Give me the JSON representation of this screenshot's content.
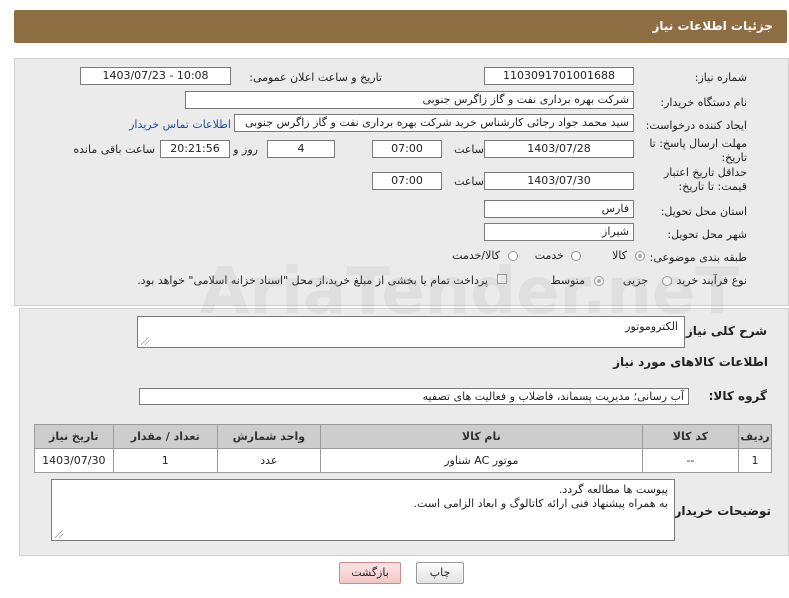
{
  "header": {
    "title": "جزئیات اطلاعات نیاز"
  },
  "form": {
    "need_number_label": "شماره نیاز:",
    "need_number": "1103091701001688",
    "announce_label": "تاریخ و ساعت اعلان عمومی:",
    "announce_value": "1403/07/23 - 10:08",
    "buyer_org_label": "نام دستگاه خریدار:",
    "buyer_org": "شرکت بهره برداری نفت و گاز زاگرس جنوبی",
    "creator_label": "ایجاد کننده درخواست:",
    "creator": "سید محمد جواد رجائی کارشناس خرید شرکت بهره برداری نفت و گاز زاگرس جنوبی",
    "contact_link": "اطلاعات تماس خریدار",
    "reply_deadline_label": "مهلت ارسال پاسخ: تا تاریخ:",
    "reply_date": "1403/07/28",
    "time_label": "ساعت",
    "reply_time": "07:00",
    "days_value": "4",
    "days_label": "روز و",
    "remaining_time": "20:21:56",
    "remaining_label": "ساعت باقی مانده",
    "price_validity_label": "حداقل تاریخ اعتبار قیمت: تا تاریخ:",
    "price_date": "1403/07/30",
    "price_time": "07:00",
    "province_label": "استان محل تحویل:",
    "province": "فارس",
    "city_label": "شهر محل تحویل:",
    "city": "شیراز",
    "category_label": "طبقه بندی موضوعی:",
    "category_options": [
      "کالا",
      "خدمت",
      "کالا/خدمت"
    ],
    "process_label": "نوع فرآیند خرید :",
    "process_options": [
      "جزیی",
      "متوسط"
    ],
    "payment_note": "پرداخت تمام یا بخشی از مبلغ خرید،از محل \"اسناد خزانه اسلامی\" خواهد بود."
  },
  "description": {
    "label": "شرح کلی نیاز:",
    "value": "الکتروموتور"
  },
  "goods": {
    "section_title": "اطلاعات کالاهای مورد نیاز",
    "group_label": "گروه کالا:",
    "group_value": "آب رسانی؛ مدیریت پسماند، فاضلاب و فعالیت های تصفیه",
    "columns": [
      "ردیف",
      "کد کالا",
      "نام کالا",
      "واحد شمارش",
      "تعداد / مقدار",
      "تاریخ نیاز"
    ],
    "rows": [
      {
        "row": "1",
        "code": "--",
        "name": "موتور AC شناور",
        "unit": "عدد",
        "qty": "1",
        "date": "1403/07/30"
      }
    ]
  },
  "buyer_notes": {
    "label": "توضیحات خریدار:",
    "line1": "پیوست ها مطالعه گردد.",
    "line2": "به همراه پیشنهاد فنی ارائه کاتالوگ و ابعاد الزامی است."
  },
  "buttons": {
    "print": "چاپ",
    "back": "بازگشت"
  },
  "watermark": "AriaTender.neT"
}
